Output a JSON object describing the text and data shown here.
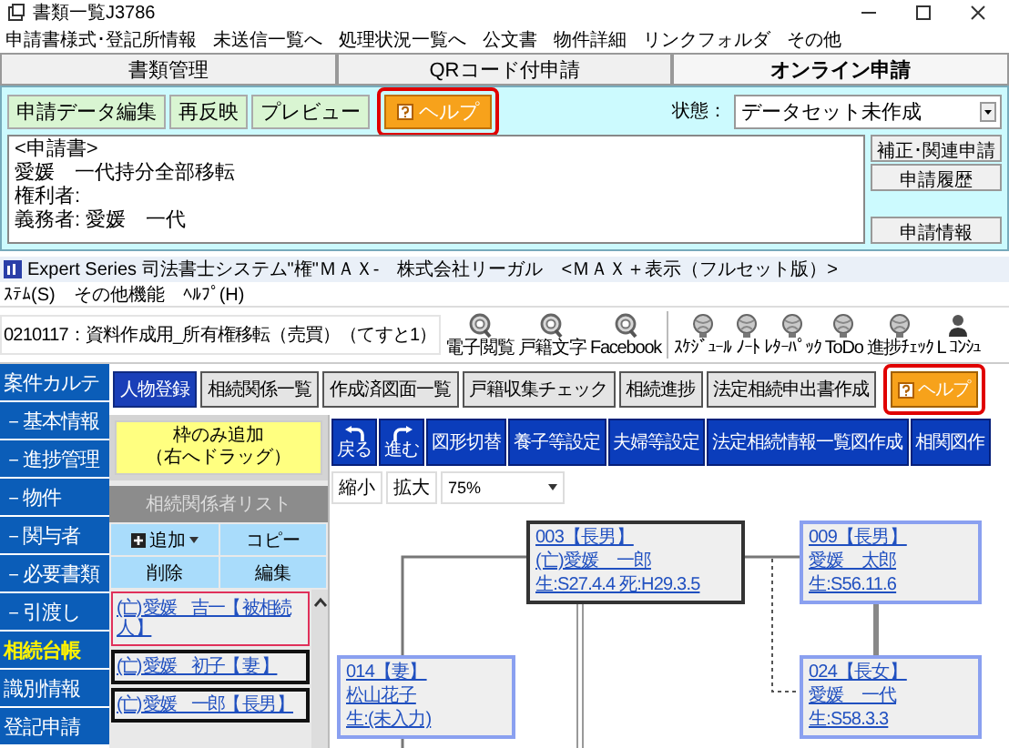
{
  "doc_window": {
    "title": "書類一覧J3786",
    "menu": [
      "申請書様式･登記所情報",
      "未送信一覧へ",
      "処理状況一覧へ",
      "公文書",
      "物件詳細",
      "リンクフォルダ",
      "その他"
    ],
    "tabs": [
      {
        "label": "書類管理",
        "selected": false
      },
      {
        "label": "QRコード付申請",
        "selected": false
      },
      {
        "label": "オンライン申請",
        "selected": true
      }
    ],
    "toolbar": [
      {
        "label": "申請データ編集",
        "kind": "button",
        "highlighted": false
      },
      {
        "label": "再反映",
        "kind": "button",
        "highlighted": false
      },
      {
        "label": "プレビュー",
        "kind": "button",
        "highlighted": false
      },
      {
        "label": "ヘルプ",
        "kind": "help",
        "highlighted": true
      }
    ],
    "status": {
      "label": "状態：",
      "value": "データセット未作成"
    },
    "preview_lines": [
      "<申請書>",
      "愛媛　一代持分全部移転",
      "権利者:",
      "義務者: 愛媛　一代"
    ],
    "side_buttons": [
      "補正･関連申請",
      "申請履歴",
      "申請情報"
    ]
  },
  "main_window": {
    "title": "Expert Series 司法書士システム\"権\"ＭＡＸ-　株式会社リーガル　<ＭＡＸ＋表示（フルセット版）>",
    "menu": [
      "ｽﾃﾑ(S)",
      "その他機能",
      "ﾍﾙﾌﾟ(H)"
    ],
    "case": "0210117：資料作成用_所有権移転（売買）（てすと1）",
    "toolbar_icons": [
      {
        "label": "電子閲覧",
        "kind": "magnifier"
      },
      {
        "label": "戸籍文字",
        "kind": "magnifier"
      },
      {
        "label": "Facebook",
        "kind": "magnifier"
      },
      {
        "label": "ｽｹｼﾞｭｰﾙ",
        "kind": "globe"
      },
      {
        "label": "ﾉｰﾄ",
        "kind": "globe"
      },
      {
        "label": "ﾚﾀｰﾊﾟｯｸ",
        "kind": "globe"
      },
      {
        "label": "ToDo",
        "kind": "globe"
      },
      {
        "label": "進捗ﾁｪｯｸ",
        "kind": "globe"
      },
      {
        "label": "L ｺﾝｼｭ",
        "kind": "person"
      }
    ],
    "nav": [
      {
        "label": "案件カルテ",
        "selected": false
      },
      {
        "label": "－基本情報",
        "selected": false
      },
      {
        "label": "－進捗管理",
        "selected": false
      },
      {
        "label": "－物件",
        "selected": false
      },
      {
        "label": "－関与者",
        "selected": false
      },
      {
        "label": "－必要書類",
        "selected": false
      },
      {
        "label": "－引渡し",
        "selected": false
      },
      {
        "label": "相続台帳",
        "selected": true
      },
      {
        "label": "識別情報",
        "selected": false
      },
      {
        "label": "登記申請",
        "selected": false
      }
    ],
    "tabs": [
      {
        "label": "人物登録",
        "kind": "tab",
        "selected": true,
        "highlighted": false
      },
      {
        "label": "相続関係一覧",
        "kind": "tab",
        "selected": false,
        "highlighted": false
      },
      {
        "label": "作成済図面一覧",
        "kind": "tab",
        "selected": false,
        "highlighted": false
      },
      {
        "label": "戸籍収集チェック",
        "kind": "tab",
        "selected": false,
        "highlighted": false
      },
      {
        "label": "相続進捗",
        "kind": "tab",
        "selected": false,
        "highlighted": false
      },
      {
        "label": "法定相続申出書作成",
        "kind": "tab",
        "selected": false,
        "highlighted": false
      },
      {
        "label": "ヘルプ",
        "kind": "help",
        "highlighted": true
      }
    ],
    "add_frame_button": [
      "枠のみ追加",
      "（右へドラッグ）"
    ],
    "person_list": {
      "title": "相続関係者リスト",
      "actions": [
        {
          "label": "追加",
          "kind": "menu"
        },
        {
          "label": "コピー",
          "kind": "plain"
        },
        {
          "label": "削除",
          "kind": "plain"
        },
        {
          "label": "編集",
          "kind": "plain"
        }
      ],
      "items": [
        {
          "label": "(亡) 愛媛　吉一【 被相続人 】",
          "selected": true
        },
        {
          "label": "(亡) 愛媛　初子【 妻 】",
          "selected": false
        },
        {
          "label": "(亡) 愛媛　一郎【 長男 】",
          "selected": false
        }
      ]
    },
    "diagram": {
      "toolbar": [
        {
          "label": "戻る",
          "kind": "undo"
        },
        {
          "label": "進む",
          "kind": "redo"
        },
        {
          "label": "図形切替",
          "kind": "text"
        },
        {
          "label": "養子等設定",
          "kind": "text"
        },
        {
          "label": "夫婦等設定",
          "kind": "text"
        },
        {
          "label": "法定相続情報一覧図作成",
          "kind": "text"
        },
        {
          "label": "相関図作",
          "kind": "text"
        }
      ],
      "zoom_buttons": [
        "縮小",
        "拡大"
      ],
      "zoom": "75%",
      "nodes": [
        {
          "lines": [
            "003【長男】",
            "(亡)愛媛　一郎",
            "生:S27.4.4 死:H29.3.5"
          ],
          "deceased": true
        },
        {
          "lines": [
            "009【長男】",
            "愛媛　太郎",
            "生:S56.11.6"
          ],
          "deceased": false
        },
        {
          "lines": [
            "014【妻】",
            "松山花子",
            "生:(未入力)"
          ],
          "deceased": false
        },
        {
          "lines": [
            "024【長女】",
            "愛媛　一代",
            "生:S58.3.3"
          ],
          "deceased": false
        }
      ]
    }
  }
}
